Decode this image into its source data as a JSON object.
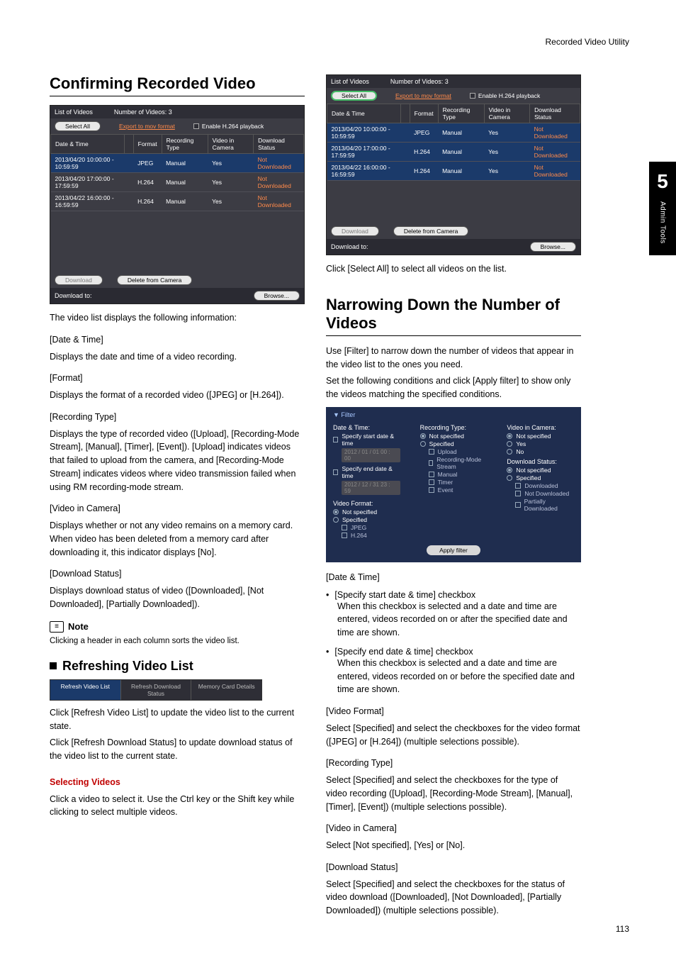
{
  "header": {
    "right": "Recorded Video Utility"
  },
  "sidetab": {
    "num": "5",
    "label": "Admin Tools"
  },
  "page_number": "113",
  "left": {
    "h1": "Confirming Recorded Video",
    "panel": {
      "list_label": "List of Videos",
      "count_label": "Number of Videos: 3",
      "select_all": "Select All",
      "export_mov": "Export to mov format",
      "enable_h264": "Enable H.264 playback",
      "cols": {
        "dt": "Date & Time",
        "fmt": "Format",
        "rt": "Recording Type",
        "vic": "Video in Camera",
        "ds": "Download Status"
      },
      "rows": [
        {
          "dt": "2013/04/20 10:00:00 - 10:59:59",
          "fmt": "JPEG",
          "rt": "Manual",
          "vic": "Yes",
          "ds": "Not Downloaded",
          "hl": true
        },
        {
          "dt": "2013/04/20 17:00:00 - 17:59:59",
          "fmt": "H.264",
          "rt": "Manual",
          "vic": "Yes",
          "ds": "Not Downloaded",
          "hl": false
        },
        {
          "dt": "2013/04/22 16:00:00 - 16:59:59",
          "fmt": "H.264",
          "rt": "Manual",
          "vic": "Yes",
          "ds": "Not Downloaded",
          "hl": false
        }
      ],
      "download": "Download",
      "delete": "Delete from Camera",
      "dl_to": "Download to:",
      "browse": "Browse..."
    },
    "intro": "The video list displays the following information:",
    "fields": [
      {
        "label": "[Date & Time]",
        "body": "Displays the date and time of a video recording."
      },
      {
        "label": "[Format]",
        "body": "Displays the format of a recorded video ([JPEG] or [H.264])."
      },
      {
        "label": "[Recording Type]",
        "body": "Displays the type of recorded video ([Upload], [Recording-Mode Stream], [Manual], [Timer], [Event]). [Upload] indicates videos that failed to upload from the camera, and [Recording-Mode Stream] indicates videos where video transmission failed when using RM recording-mode stream."
      },
      {
        "label": "[Video in Camera]",
        "body": "Displays whether or not any video remains on a memory card. When video has been deleted from a memory card after downloading it, this indicator displays [No]."
      },
      {
        "label": "[Download Status]",
        "body": "Displays download status of video ([Downloaded], [Not Downloaded], [Partially Downloaded])."
      }
    ],
    "note_label": "Note",
    "note_text": "Clicking a header in each column sorts the video list.",
    "h2": "Refreshing Video List",
    "refbar": {
      "a": "Refresh Video List",
      "b": "Refresh Download Status",
      "c": "Memory Card Details"
    },
    "refresh_p1": "Click [Refresh Video List] to update the video list to the current state.",
    "refresh_p2": "Click [Refresh Download Status] to update download status of the video list to the current state.",
    "sel_title": "Selecting Videos",
    "sel_body": "Click a video to select it. Use the Ctrl key or the Shift key while clicking to select multiple videos."
  },
  "right": {
    "panel_caption": "Click [Select All] to select all videos on the list.",
    "h1": "Narrowing Down the Number of Videos",
    "intro1": "Use [Filter] to narrow down the number of videos that appear in the video list to the ones you need.",
    "intro2": "Set the following conditions and click [Apply filter] to show only the videos matching the specified conditions.",
    "filter": {
      "title": "▼ Filter",
      "col1": {
        "dt": "Date & Time:",
        "start": "Specify start date & time",
        "start_val": "2012 / 01 / 01 00 : 00",
        "end": "Specify end date & time",
        "end_val": "2012 / 12 / 31 23 : 59",
        "vf": "Video Format:",
        "ns": "Not specified",
        "sp": "Specified",
        "jpeg": "JPEG",
        "h264": "H.264"
      },
      "col2": {
        "rt": "Recording Type:",
        "ns": "Not specified",
        "sp": "Specified",
        "upload": "Upload",
        "rms": "Recording-Mode Stream",
        "manual": "Manual",
        "timer": "Timer",
        "event": "Event"
      },
      "col3": {
        "vic": "Video in Camera:",
        "ns": "Not specified",
        "yes": "Yes",
        "no": "No",
        "ds": "Download Status:",
        "ns2": "Not specified",
        "sp": "Specified",
        "dl": "Downloaded",
        "ndl": "Not Downloaded",
        "pdl": "Partially Downloaded"
      },
      "apply": "Apply filter"
    },
    "blocks": {
      "dt_label": "[Date & Time]",
      "b1_head": "[Specify start date & time] checkbox",
      "b1_body": "When this checkbox is selected and a date and time are entered, videos recorded on or after the specified date and time are shown.",
      "b2_head": "[Specify end date & time] checkbox",
      "b2_body": "When this checkbox is selected and a date and time are entered, videos recorded on or before the specified date and time are shown.",
      "vf_label": "[Video Format]",
      "vf_body": "Select [Specified] and select the checkboxes for the video format ([JPEG] or [H.264]) (multiple selections possible).",
      "rt_label": "[Recording Type]",
      "rt_body": "Select [Specified] and select the checkboxes for the type of video recording ([Upload], [Recording-Mode Stream], [Manual], [Timer], [Event]) (multiple selections possible).",
      "vic_label": "[Video in Camera]",
      "vic_body": "Select [Not specified], [Yes] or [No].",
      "ds_label": "[Download Status]",
      "ds_body": "Select [Specified] and select the checkboxes for the status of video download ([Downloaded], [Not Downloaded], [Partially Downloaded]) (multiple selections possible)."
    }
  }
}
